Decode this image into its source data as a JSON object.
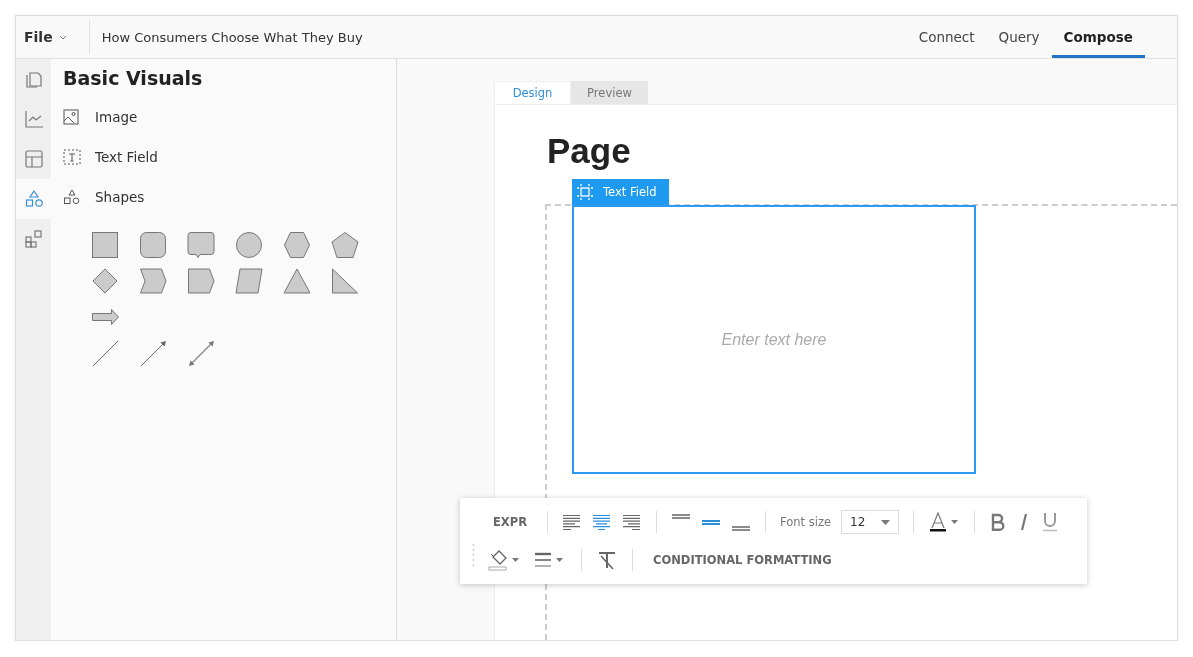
{
  "menu": {
    "label": "File"
  },
  "document_title": "How Consumers Choose What They Buy",
  "nav_tabs": [
    {
      "label": "Connect",
      "selected": false
    },
    {
      "label": "Query",
      "selected": false
    },
    {
      "label": "Compose",
      "selected": true
    }
  ],
  "side_rail": [
    {
      "kind": "pages",
      "selected": false
    },
    {
      "kind": "chart",
      "selected": false
    },
    {
      "kind": "table",
      "selected": false
    },
    {
      "kind": "shapes",
      "selected": true
    },
    {
      "kind": "widgets",
      "selected": false
    }
  ],
  "panel": {
    "title": "Basic Visuals",
    "items": [
      {
        "kind": "image",
        "label": "Image"
      },
      {
        "kind": "textfield",
        "label": "Text Field"
      },
      {
        "kind": "shapes",
        "label": "Shapes"
      }
    ],
    "shape_rows": [
      [
        {
          "kind": "square"
        },
        {
          "kind": "rounded"
        },
        {
          "kind": "callout"
        },
        {
          "kind": "circle"
        },
        {
          "kind": "hexagon"
        },
        {
          "kind": "pentagon"
        }
      ],
      [
        {
          "kind": "diamond"
        },
        {
          "kind": "chevron"
        },
        {
          "kind": "tag"
        },
        {
          "kind": "parallelogram"
        },
        {
          "kind": "triangle"
        },
        {
          "kind": "right-triangle"
        }
      ],
      [
        {
          "kind": "arrow"
        }
      ],
      [
        {
          "kind": "line"
        },
        {
          "kind": "line-arrow"
        },
        {
          "kind": "line-double-arrow"
        }
      ]
    ]
  },
  "canvas_tabs": [
    {
      "label": "Design",
      "selected": true
    },
    {
      "label": "Preview",
      "selected": false
    }
  ],
  "page_title": "Page",
  "text_field": {
    "label": "Text Field",
    "placeholder": "Enter text here"
  },
  "toolbar": {
    "rows": [
      [
        {
          "kind": "text-button",
          "label": "EXPR"
        },
        {
          "kind": "sep"
        },
        {
          "kind": "align-left",
          "selected": false
        },
        {
          "kind": "align-center",
          "selected": true
        },
        {
          "kind": "align-right",
          "selected": false
        },
        {
          "kind": "sep"
        },
        {
          "kind": "valign-top",
          "selected": false
        },
        {
          "kind": "valign-middle",
          "selected": true
        },
        {
          "kind": "valign-bottom",
          "selected": false
        },
        {
          "kind": "sep"
        },
        {
          "kind": "label",
          "label": "Font size"
        },
        {
          "kind": "select",
          "value": "12"
        },
        {
          "kind": "sep"
        },
        {
          "kind": "font-color"
        },
        {
          "kind": "sep"
        },
        {
          "kind": "bold"
        },
        {
          "kind": "italic"
        },
        {
          "kind": "underline"
        }
      ],
      [
        {
          "kind": "fill"
        },
        {
          "kind": "border"
        },
        {
          "kind": "sep"
        },
        {
          "kind": "clear-format"
        },
        {
          "kind": "sep"
        },
        {
          "kind": "text-button",
          "label": "CONDITIONAL FORMATTING"
        }
      ]
    ]
  }
}
